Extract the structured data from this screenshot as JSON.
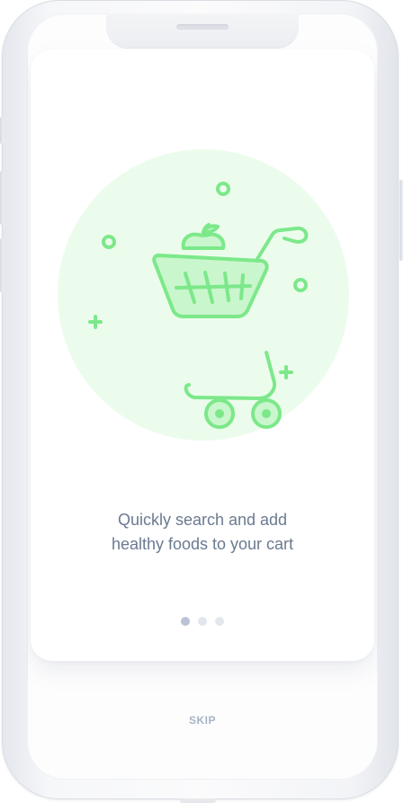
{
  "onboarding": {
    "tagline": "Quickly search and add\nhealthy foods to your cart",
    "skip_label": "SKIP",
    "page_count": 3,
    "active_page": 1
  },
  "illustration": {
    "icon": "shopping-cart-icon",
    "circle_color": "#ecfcec",
    "stroke_color": "#7ce88a",
    "fill_color": "#c9f6cc"
  },
  "colors": {
    "text": "#6b7a90",
    "skip": "#a7b3c5",
    "dot_active": "#b9c3d3",
    "dot_inactive": "#e3e6ec"
  }
}
